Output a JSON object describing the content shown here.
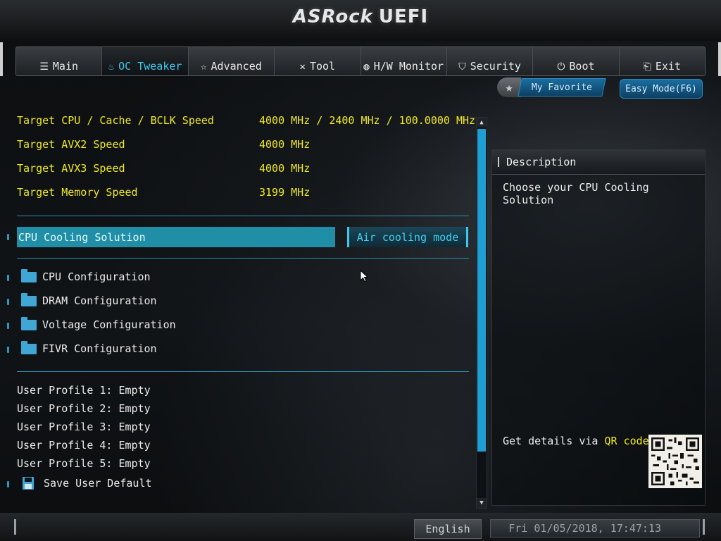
{
  "header": {
    "brand": "ASRock",
    "product": "UEFI"
  },
  "tabs": [
    {
      "label": "Main",
      "icon": "list-icon",
      "glyph": "☰",
      "active": false
    },
    {
      "label": "OC Tweaker",
      "icon": "flame-icon",
      "glyph": "♨",
      "active": true
    },
    {
      "label": "Advanced",
      "icon": "star-icon",
      "glyph": "☆",
      "active": false
    },
    {
      "label": "Tool",
      "icon": "tools-icon",
      "glyph": "✕",
      "active": false
    },
    {
      "label": "H/W Monitor",
      "icon": "monitor-icon",
      "glyph": "◍",
      "active": false
    },
    {
      "label": "Security",
      "icon": "shield-icon",
      "glyph": "⛉",
      "active": false
    },
    {
      "label": "Boot",
      "icon": "power-icon",
      "glyph": "⏻",
      "active": false
    },
    {
      "label": "Exit",
      "icon": "exit-icon",
      "glyph": "⎗",
      "active": false
    }
  ],
  "favorites": {
    "my_favorite_label": "My Favorite",
    "easy_mode_label": "Easy Mode(F6)"
  },
  "targets": [
    {
      "label": "Target CPU / Cache / BCLK Speed",
      "value": "4000 MHz / 2400 MHz / 100.0000 MHz"
    },
    {
      "label": "Target AVX2 Speed",
      "value": "4000 MHz"
    },
    {
      "label": "Target AVX3 Speed",
      "value": "4000 MHz"
    },
    {
      "label": "Target Memory Speed",
      "value": "3199 MHz"
    }
  ],
  "cooling": {
    "label": "CPU Cooling Solution",
    "value": "Air cooling mode"
  },
  "folders": [
    {
      "label": "CPU Configuration"
    },
    {
      "label": "DRAM Configuration"
    },
    {
      "label": "Voltage Configuration"
    },
    {
      "label": "FIVR Configuration"
    }
  ],
  "profiles": [
    {
      "label": "User Profile 1: Empty"
    },
    {
      "label": "User Profile 2: Empty"
    },
    {
      "label": "User Profile 3: Empty"
    },
    {
      "label": "User Profile 4: Empty"
    },
    {
      "label": "User Profile 5: Empty"
    }
  ],
  "save_default_label": "Save User Default",
  "description": {
    "title": "Description",
    "text": "Choose your CPU Cooling Solution",
    "qr_prefix": "Get details via ",
    "qr_link": "QR code"
  },
  "footer": {
    "language": "English",
    "datetime": "Fri 01/05/2018, 17:47:13"
  },
  "colors": {
    "accent": "#3fc8ec",
    "highlight_row": "#1f8ea6",
    "target_text": "#f0ea1e",
    "scroll_thumb": "#1e9ed2"
  }
}
